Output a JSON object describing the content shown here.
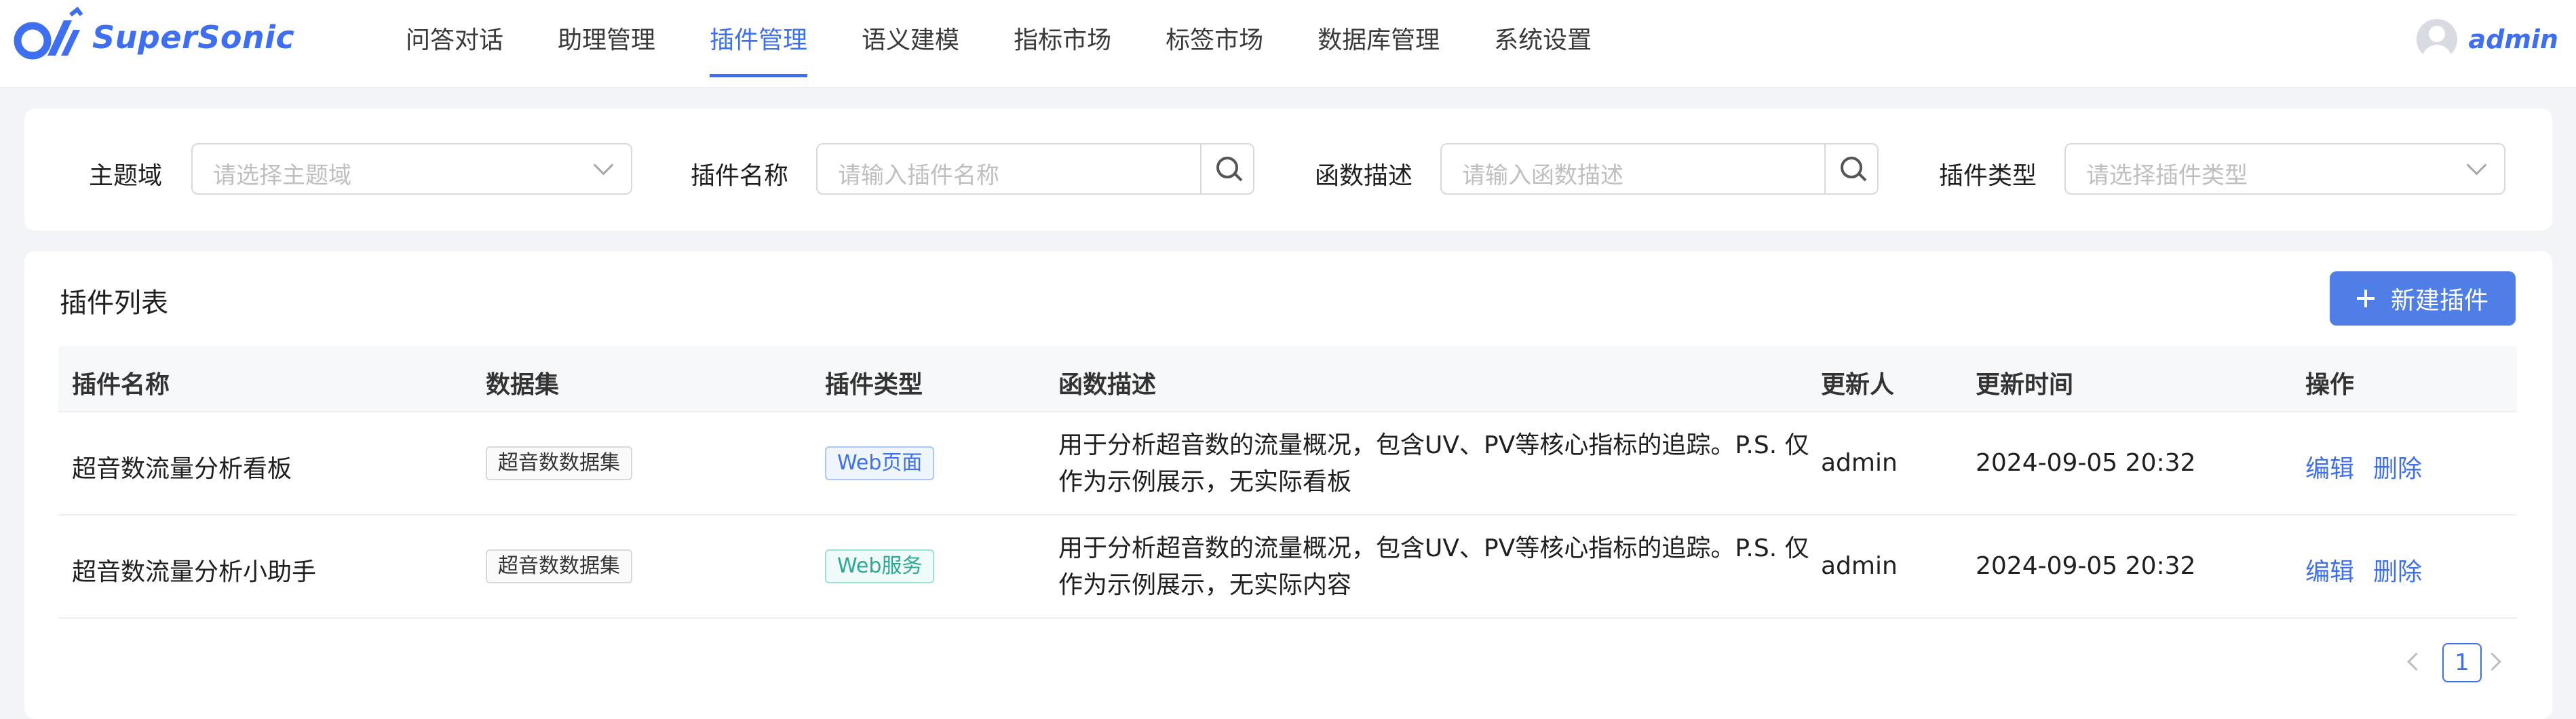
{
  "brand": {
    "name": "SuperSonic"
  },
  "nav": {
    "items": [
      {
        "label": "问答对话"
      },
      {
        "label": "助理管理"
      },
      {
        "label": "插件管理",
        "active": true
      },
      {
        "label": "语义建模"
      },
      {
        "label": "指标市场"
      },
      {
        "label": "标签市场"
      },
      {
        "label": "数据库管理"
      },
      {
        "label": "系统设置"
      }
    ]
  },
  "user": {
    "name": "admin"
  },
  "filters": {
    "domain": {
      "label": "主题域",
      "placeholder": "请选择主题域"
    },
    "plugin_name": {
      "label": "插件名称",
      "placeholder": "请输入插件名称"
    },
    "func_desc": {
      "label": "函数描述",
      "placeholder": "请输入函数描述"
    },
    "plugin_type": {
      "label": "插件类型",
      "placeholder": "请选择插件类型"
    }
  },
  "table": {
    "title": "插件列表",
    "new_button": "新建插件",
    "columns": [
      "插件名称",
      "数据集",
      "插件类型",
      "函数描述",
      "更新人",
      "更新时间",
      "操作"
    ],
    "rows": [
      {
        "name": "超音数流量分析看板",
        "dataset": "超音数数据集",
        "type": "Web页面",
        "desc_line1": "用于分析超音数的流量概况，包含UV、PV等核心指标的追踪。P.S. 仅",
        "desc_line2": "作为示例展示，无实际看板",
        "updater": "admin",
        "updated_at": "2024-09-05 20:32",
        "edit": "编辑",
        "delete": "删除"
      },
      {
        "name": "超音数流量分析小助手",
        "dataset": "超音数数据集",
        "type": "Web服务",
        "desc_line1": "用于分析超音数的流量概况，包含UV、PV等核心指标的追踪。P.S. 仅",
        "desc_line2": "作为示例展示，无实际内容",
        "updater": "admin",
        "updated_at": "2024-09-05 20:32",
        "edit": "编辑",
        "delete": "删除"
      }
    ]
  },
  "pagination": {
    "current": "1"
  },
  "colors": {
    "accent": "#3d6ff0",
    "button": "#4f7ee6",
    "page_bg": "#f3f4f8"
  }
}
